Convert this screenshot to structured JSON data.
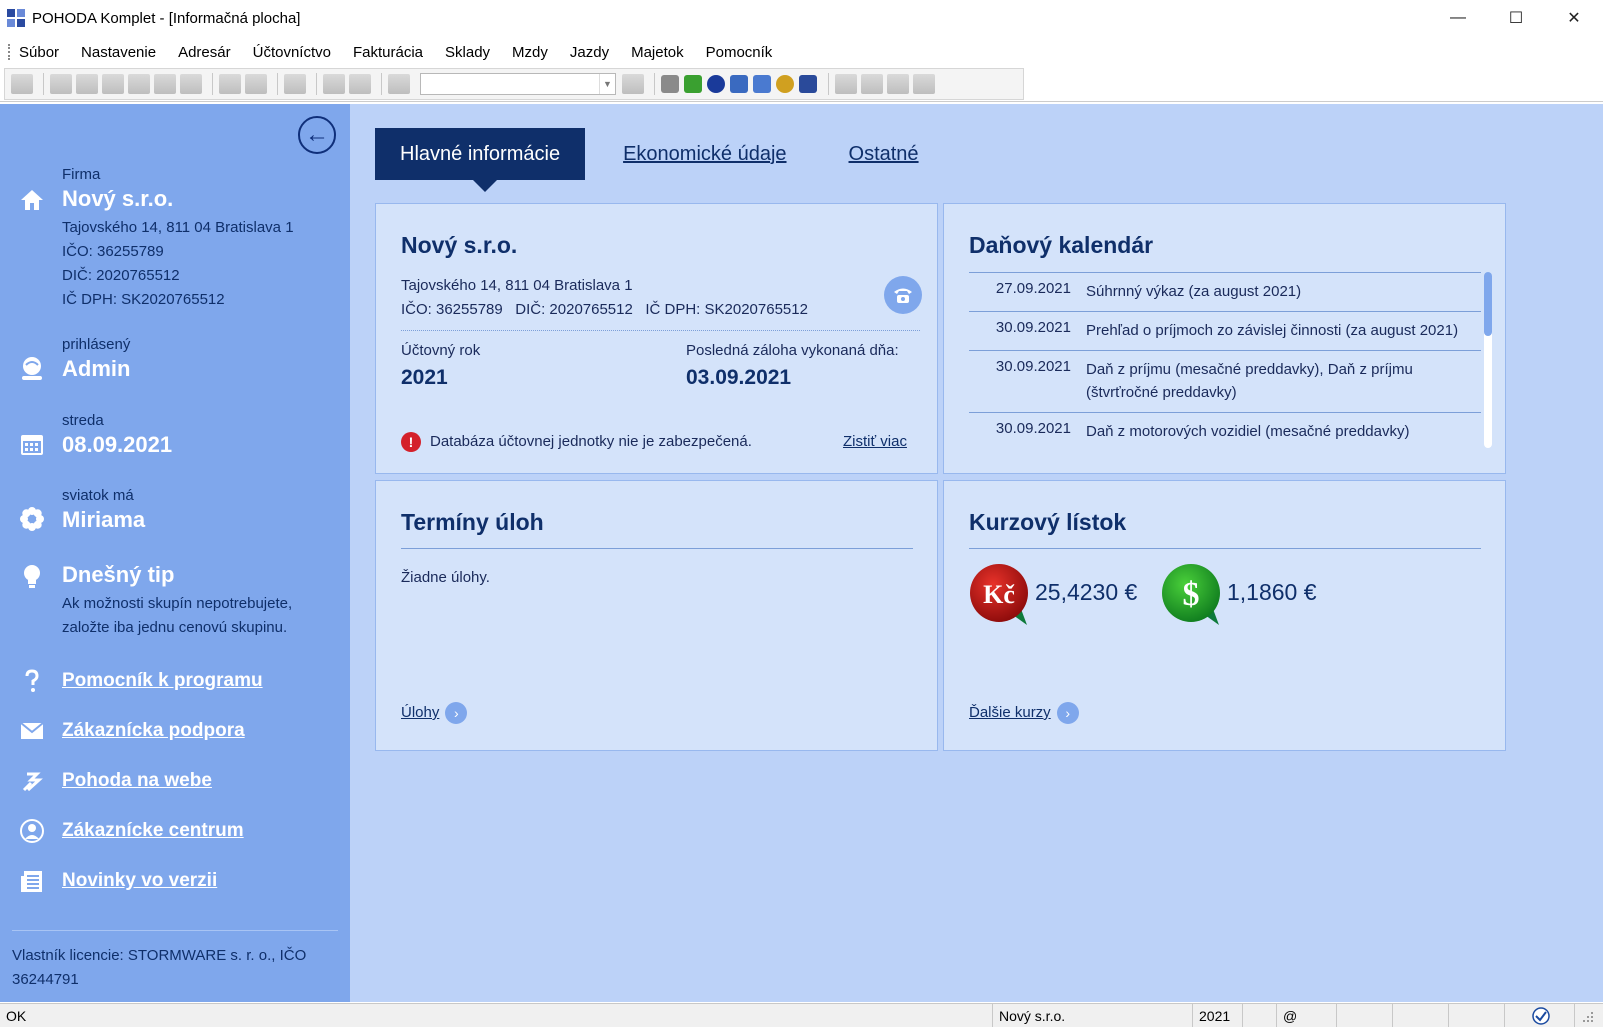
{
  "window": {
    "title": "POHODA Komplet - [Informačná plocha]",
    "minimize": "—",
    "maximize": "☐",
    "close": "✕"
  },
  "menu": [
    "Súbor",
    "Nastavenie",
    "Adresár",
    "Účtovníctvo",
    "Fakturácia",
    "Sklady",
    "Mzdy",
    "Jazdy",
    "Majetok",
    "Pomocník"
  ],
  "sidebar": {
    "collapse_glyph": "←",
    "company": {
      "label": "Firma",
      "name": "Nový s.r.o.",
      "address": "Tajovského 14, 811 04 Bratislava 1",
      "ico": "IČO: 36255789",
      "dic": "DIČ: 2020765512",
      "icdph": "IČ DPH: SK2020765512"
    },
    "user": {
      "label": "prihlásený",
      "value": "Admin"
    },
    "date": {
      "label": "streda",
      "value": "08.09.2021"
    },
    "nameday": {
      "label": "sviatok má",
      "value": "Miriama"
    },
    "tip": {
      "title": "Dnešný tip",
      "line1": "Ak možnosti skupín nepotrebujete,",
      "line2": "založte iba jednu cenovú skupinu."
    },
    "links": {
      "help": "Pomocník k programu",
      "support": "Zákaznícka podpora",
      "web": "Pohoda na webe",
      "center": "Zákaznícke centrum",
      "news": "Novinky vo verzii"
    },
    "license_line1": "Vlastník licencie: STORMWARE s. r. o., IČO",
    "license_line2": "36244791"
  },
  "tabs": {
    "main": "Hlavné informácie",
    "economic": "Ekonomické údaje",
    "other": "Ostatné"
  },
  "info_card": {
    "title": "Nový s.r.o.",
    "address": "Tajovského 14, 811 04 Bratislava 1",
    "ids": "IČO: 36255789   DIČ: 2020765512   IČ DPH: SK2020765512",
    "year_label": "Účtovný rok",
    "year_value": "2021",
    "backup_label": "Posledná záloha vykonaná dňa:",
    "backup_value": "03.09.2021",
    "warning_glyph": "!",
    "warning": "Databáza účtovnej jednotky nie je zabezpečená.",
    "warning_link": "Zistiť viac"
  },
  "calendar_card": {
    "title": "Daňový kalendár",
    "rows": [
      {
        "date": "27.09.2021",
        "desc": "Súhrnný výkaz (za august 2021)"
      },
      {
        "date": "30.09.2021",
        "desc": "Prehľad o príjmoch zo závislej činnosti (za august 2021)"
      },
      {
        "date": "30.09.2021",
        "desc": "Daň z príjmu (mesačné preddavky), Daň z príjmu (štvrťročné preddavky)"
      },
      {
        "date": "30.09.2021",
        "desc": "Daň z motorových vozidiel (mesačné preddavky)"
      }
    ]
  },
  "tasks_card": {
    "title": "Termíny úloh",
    "empty": "Žiadne úlohy.",
    "link": "Úlohy",
    "link_glyph": "›"
  },
  "rates_card": {
    "title": "Kurzový lístok",
    "czk_symbol": "Kč",
    "czk_value": "25,4230 €",
    "usd_symbol": "$",
    "usd_value": "1,1860 €",
    "link": "Ďalšie kurzy",
    "link_glyph": "›"
  },
  "statusbar": {
    "status": "OK",
    "company": "Nový s.r.o.",
    "year": "2021",
    "at": "@"
  },
  "colors": {
    "sidebar": "#7fa7ec",
    "main_bg": "#bcd2f8",
    "card_bg": "#d4e3fa",
    "navy": "#0f2f6a",
    "warning": "#d4202a"
  }
}
